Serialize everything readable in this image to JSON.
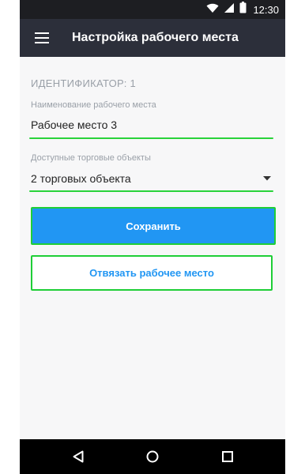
{
  "status_bar": {
    "time": "12:30",
    "icons": [
      "wifi-icon",
      "cellular-signal-icon",
      "battery-icon"
    ]
  },
  "app_bar": {
    "menu_icon": "hamburger-menu-icon",
    "title": "Настройка рабочего места"
  },
  "form": {
    "identifier": "ИДЕНТИФИКАТОР: 1",
    "workplace_name": {
      "label": "Наименование рабочего места",
      "value": "Рабочее место 3"
    },
    "stores": {
      "label": "Доступные торговые объекты",
      "value": "2 торговых объекта",
      "icon": "dropdown-arrow-icon"
    }
  },
  "buttons": {
    "save_label": "Сохранить",
    "unbind_label": "Отвязать рабочее место"
  },
  "nav_bar": {
    "icons": [
      "back-icon",
      "home-icon",
      "recents-icon"
    ]
  },
  "colors": {
    "status_bar": "#1d1e22",
    "app_bar": "#2c2f3a",
    "accent_blue": "#2196f3",
    "highlight_green": "#29d33a",
    "background": "#f7f7f8"
  }
}
